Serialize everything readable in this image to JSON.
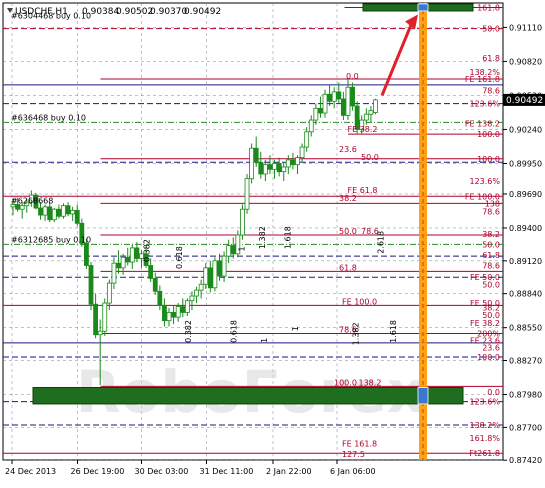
{
  "header": {
    "symbol": "USDCHF,H1",
    "open": "0.90384",
    "high": "0.90502",
    "low": "0.90370",
    "close": "0.90492"
  },
  "watermark": "RoboForex",
  "current_price_label": "0.90492",
  "colors": {
    "candle_up": "#1a8a1a",
    "candle_down": "#1a8a1a",
    "level_red": "#b0002a",
    "level_blue": "#1a1a80",
    "grid": "#3a4a8a",
    "orange_line": "#ff9900",
    "green_box": "#1f6e1f",
    "arrow": "#e0202a",
    "fib_label": "#b0002a"
  },
  "chart_data": {
    "type": "candlestick",
    "title": "USDCHF,H1",
    "xlabel": "",
    "ylabel": "",
    "ylim": [
      0.87422,
      0.91318
    ],
    "y_ticks": [
      "0.91110",
      "0.90820",
      "0.90530",
      "0.90240",
      "0.89950",
      "0.89690",
      "0.89400",
      "0.89120",
      "0.88840",
      "0.88550",
      "0.88270",
      "0.87980",
      "0.87700",
      "0.87420"
    ],
    "x_ticks": [
      "24 Dec 2013",
      "26 Dec 19:00",
      "30 Dec 03:00",
      "31 Dec 11:00",
      "2 Jan 22:00",
      "6 Jan 06:00"
    ],
    "right_fib_labels": [
      {
        "text": "161.8",
        "price": 0.9128
      },
      {
        "text": "50.0",
        "price": 0.911
      },
      {
        "text": "61.8",
        "price": 0.9085
      },
      {
        "text": "138.2%",
        "price": 0.9073
      },
      {
        "text": "FE 161.8",
        "price": 0.9067
      },
      {
        "text": "78.6",
        "price": 0.9057
      },
      {
        "text": "123.6%",
        "price": 0.9046
      },
      {
        "text": "FE 138.2",
        "price": 0.9029
      },
      {
        "text": "100.0",
        "price": 0.902
      },
      {
        "text": "100.0",
        "price": 0.8999
      },
      {
        "text": "123.6%",
        "price": 0.898
      },
      {
        "text": "FE 100.0",
        "price": 0.8967
      },
      {
        "text": "138",
        "price": 0.8961
      },
      {
        "text": "78.6",
        "price": 0.8954
      },
      {
        "text": "38.2",
        "price": 0.8935
      },
      {
        "text": "50.0",
        "price": 0.8926
      },
      {
        "text": "61.8",
        "price": 0.8917
      },
      {
        "text": "78.6",
        "price": 0.8908
      },
      {
        "text": "FE 50.0",
        "price": 0.8898
      },
      {
        "text": "50.0",
        "price": 0.8892
      },
      {
        "text": "FE 50.0",
        "price": 0.8876
      },
      {
        "text": "38.2",
        "price": 0.8872
      },
      {
        "text": "50.0",
        "price": 0.8866
      },
      {
        "text": "FE 38.2",
        "price": 0.8859
      },
      {
        "text": "200%",
        "price": 0.885
      },
      {
        "text": "FE 23.6",
        "price": 0.8844
      },
      {
        "text": "23.6",
        "price": 0.8838
      },
      {
        "text": "100.0",
        "price": 0.883
      },
      {
        "text": "0.0",
        "price": 0.88
      },
      {
        "text": "123.6%",
        "price": 0.8792
      },
      {
        "text": "138.2%",
        "price": 0.8772
      },
      {
        "text": "161.8%",
        "price": 0.8761
      },
      {
        "text": "Ft261.8",
        "price": 0.8748
      }
    ],
    "inner_fib_labels": [
      {
        "text": "0.0",
        "price": 0.9066,
        "offset": 0.686
      },
      {
        "text": "FE 38.2",
        "price": 0.9021,
        "offset": 0.689
      },
      {
        "text": "23.6",
        "price": 0.9004,
        "offset": 0.672
      },
      {
        "text": "50.0",
        "price": 0.8997,
        "offset": 0.716
      },
      {
        "text": "FE 61.8",
        "price": 0.8969,
        "offset": 0.689
      },
      {
        "text": "38.2",
        "price": 0.8962,
        "offset": 0.672
      },
      {
        "text": "50.0",
        "price": 0.8934,
        "offset": 0.672
      },
      {
        "text": "78.6",
        "price": 0.8934,
        "offset": 0.716
      },
      {
        "text": "61.8",
        "price": 0.8903,
        "offset": 0.672
      },
      {
        "text": "FE 100.0",
        "price": 0.8874,
        "offset": 0.678
      },
      {
        "text": "78.6",
        "price": 0.885,
        "offset": 0.672
      },
      {
        "text": "100.0",
        "price": 0.8805,
        "offset": 0.662
      },
      {
        "text": "138.2",
        "price": 0.8805,
        "offset": 0.711
      },
      {
        "text": "FE 161.8",
        "price": 0.8753,
        "offset": 0.678
      },
      {
        "text": "127.5",
        "price": 0.8744,
        "offset": 0.678
      }
    ],
    "order_labels": [
      {
        "text": "#636468 buy 0.10",
        "price": 0.903
      },
      {
        "text": "#6268668",
        "price": 0.8959
      },
      {
        "text": "#6312685 buy 0.10",
        "price": 0.8926
      },
      {
        "text": "#6304468 buy 0.10",
        "price": 0.9117
      }
    ],
    "vertical_fib_labels": [
      {
        "text": "0.382",
        "price": 0.8911,
        "offset": 0.293
      },
      {
        "text": "0.618",
        "price": 0.8905,
        "offset": 0.358
      },
      {
        "text": "0.382",
        "price": 0.8842,
        "offset": 0.376
      },
      {
        "text": "0.618",
        "price": 0.8842,
        "offset": 0.467
      },
      {
        "text": "1",
        "price": 0.8842,
        "offset": 0.528
      },
      {
        "text": "1",
        "price": 0.892,
        "offset": 0.483
      },
      {
        "text": "1.382",
        "price": 0.8922,
        "offset": 0.524
      },
      {
        "text": "1.618",
        "price": 0.8922,
        "offset": 0.575
      },
      {
        "text": "2.618",
        "price": 0.8918,
        "offset": 0.761
      },
      {
        "text": "1",
        "price": 0.8852,
        "offset": 0.59
      },
      {
        "text": "1.382",
        "price": 0.884,
        "offset": 0.711
      },
      {
        "text": "1.618",
        "price": 0.8842,
        "offset": 0.786
      }
    ],
    "candles": [
      [
        0.8958,
        0.8965,
        0.8951,
        0.896
      ],
      [
        0.896,
        0.8966,
        0.8954,
        0.8956
      ],
      [
        0.8956,
        0.8962,
        0.8948,
        0.8959
      ],
      [
        0.8959,
        0.8965,
        0.8953,
        0.8962
      ],
      [
        0.8962,
        0.8972,
        0.8958,
        0.8968
      ],
      [
        0.8968,
        0.897,
        0.8956,
        0.8957
      ],
      [
        0.8957,
        0.8962,
        0.8947,
        0.8951
      ],
      [
        0.8951,
        0.896,
        0.8946,
        0.8958
      ],
      [
        0.8958,
        0.8962,
        0.8945,
        0.8947
      ],
      [
        0.8947,
        0.8957,
        0.8945,
        0.8956
      ],
      [
        0.8956,
        0.896,
        0.8948,
        0.895
      ],
      [
        0.895,
        0.8961,
        0.8948,
        0.8959
      ],
      [
        0.8959,
        0.8962,
        0.895,
        0.8952
      ],
      [
        0.8952,
        0.8958,
        0.8946,
        0.8955
      ],
      [
        0.8955,
        0.896,
        0.8942,
        0.8944
      ],
      [
        0.8944,
        0.8948,
        0.8924,
        0.8927
      ],
      [
        0.8927,
        0.8931,
        0.8905,
        0.8908
      ],
      [
        0.8908,
        0.8911,
        0.887,
        0.8875
      ],
      [
        0.8875,
        0.8884,
        0.8846,
        0.8849
      ],
      [
        0.8849,
        0.8862,
        0.8806,
        0.8852
      ],
      [
        0.8852,
        0.888,
        0.8848,
        0.8876
      ],
      [
        0.8876,
        0.8896,
        0.887,
        0.8893
      ],
      [
        0.8893,
        0.8915,
        0.8888,
        0.891
      ],
      [
        0.891,
        0.8921,
        0.8901,
        0.8906
      ],
      [
        0.8906,
        0.8918,
        0.89,
        0.8915
      ],
      [
        0.8915,
        0.8923,
        0.8908,
        0.8911
      ],
      [
        0.8911,
        0.8926,
        0.8905,
        0.8923
      ],
      [
        0.8923,
        0.8928,
        0.8911,
        0.8914
      ],
      [
        0.8914,
        0.8921,
        0.8906,
        0.8918
      ],
      [
        0.8918,
        0.8924,
        0.8906,
        0.8908
      ],
      [
        0.8908,
        0.8914,
        0.8894,
        0.8897
      ],
      [
        0.8897,
        0.8902,
        0.8883,
        0.8886
      ],
      [
        0.8886,
        0.8891,
        0.887,
        0.8874
      ],
      [
        0.8874,
        0.888,
        0.8856,
        0.8861
      ],
      [
        0.8861,
        0.8872,
        0.8856,
        0.8868
      ],
      [
        0.8868,
        0.8874,
        0.8858,
        0.8864
      ],
      [
        0.8864,
        0.8876,
        0.886,
        0.8873
      ],
      [
        0.8873,
        0.888,
        0.8864,
        0.8868
      ],
      [
        0.8868,
        0.888,
        0.8865,
        0.8878
      ],
      [
        0.8878,
        0.8886,
        0.887,
        0.8882
      ],
      [
        0.8882,
        0.889,
        0.8876,
        0.8887
      ],
      [
        0.8887,
        0.8896,
        0.888,
        0.8892
      ],
      [
        0.8892,
        0.891,
        0.8888,
        0.8906
      ],
      [
        0.8906,
        0.8912,
        0.8885,
        0.8889
      ],
      [
        0.8889,
        0.8915,
        0.8886,
        0.8912
      ],
      [
        0.8912,
        0.8918,
        0.8895,
        0.8899
      ],
      [
        0.8899,
        0.892,
        0.8894,
        0.8916
      ],
      [
        0.8916,
        0.893,
        0.891,
        0.8925
      ],
      [
        0.8925,
        0.8932,
        0.8914,
        0.8918
      ],
      [
        0.8918,
        0.8938,
        0.8915,
        0.8934
      ],
      [
        0.8934,
        0.896,
        0.893,
        0.8956
      ],
      [
        0.8956,
        0.8986,
        0.8952,
        0.8982
      ],
      [
        0.8982,
        0.9012,
        0.8978,
        0.9008
      ],
      [
        0.9008,
        0.9018,
        0.8992,
        0.8996
      ],
      [
        0.8996,
        0.9005,
        0.8982,
        0.8986
      ],
      [
        0.8986,
        0.8998,
        0.898,
        0.8994
      ],
      [
        0.8994,
        0.9002,
        0.8986,
        0.899
      ],
      [
        0.899,
        0.8998,
        0.8982,
        0.8995
      ],
      [
        0.8995,
        0.9,
        0.8984,
        0.8988
      ],
      [
        0.8988,
        0.8996,
        0.898,
        0.8992
      ],
      [
        0.8992,
        0.9002,
        0.8986,
        0.8998
      ],
      [
        0.8998,
        0.9004,
        0.899,
        0.8994
      ],
      [
        0.8994,
        0.9002,
        0.8986,
        0.9
      ],
      [
        0.9,
        0.9012,
        0.8996,
        0.9009
      ],
      [
        0.9009,
        0.9026,
        0.9005,
        0.9022
      ],
      [
        0.9022,
        0.9036,
        0.9018,
        0.9032
      ],
      [
        0.9032,
        0.9046,
        0.9028,
        0.9042
      ],
      [
        0.9042,
        0.9052,
        0.9034,
        0.9038
      ],
      [
        0.9038,
        0.9058,
        0.9034,
        0.9054
      ],
      [
        0.9054,
        0.9062,
        0.9044,
        0.9048
      ],
      [
        0.9048,
        0.906,
        0.9042,
        0.9056
      ],
      [
        0.9056,
        0.9064,
        0.9046,
        0.905
      ],
      [
        0.905,
        0.9056,
        0.9032,
        0.9036
      ],
      [
        0.9036,
        0.9068,
        0.9032,
        0.906
      ],
      [
        0.906,
        0.9064,
        0.904,
        0.9044
      ],
      [
        0.9044,
        0.9048,
        0.902,
        0.9024
      ],
      [
        0.9024,
        0.9036,
        0.902,
        0.9032
      ],
      [
        0.9032,
        0.9042,
        0.9028,
        0.9037
      ],
      [
        0.9037,
        0.9044,
        0.903,
        0.904
      ],
      [
        0.90384,
        0.90502,
        0.9037,
        0.90492
      ]
    ],
    "horizontal_levels": [
      {
        "price": 0.9128,
        "style": "solid",
        "color": "red",
        "from": 0.683
      },
      {
        "price": 0.911,
        "style": "dash",
        "color": "red",
        "from": 0.0
      },
      {
        "price": 0.9067,
        "style": "solid",
        "color": "red",
        "from": 0.195
      },
      {
        "price": 0.9062,
        "style": "solid",
        "color": "blue",
        "from": 0.0
      },
      {
        "price": 0.9046,
        "style": "dash",
        "color": "blue",
        "from": 0.0
      },
      {
        "price": 0.903,
        "style": "dashdot",
        "color": "green",
        "from": 0.0
      },
      {
        "price": 0.902,
        "style": "solid",
        "color": "red",
        "from": 0.69
      },
      {
        "price": 0.8999,
        "style": "solid",
        "color": "red",
        "from": 0.195
      },
      {
        "price": 0.8996,
        "style": "dash",
        "color": "blue",
        "from": 0.0
      },
      {
        "price": 0.8967,
        "style": "solid",
        "color": "red",
        "from": 0.0
      },
      {
        "price": 0.8961,
        "style": "solid",
        "color": "red",
        "from": 0.195
      },
      {
        "price": 0.8934,
        "style": "solid",
        "color": "red",
        "from": 0.195
      },
      {
        "price": 0.8926,
        "style": "dashdot",
        "color": "green",
        "from": 0.0
      },
      {
        "price": 0.8916,
        "style": "dash",
        "color": "blue",
        "from": 0.0
      },
      {
        "price": 0.8903,
        "style": "solid",
        "color": "red",
        "from": 0.195
      },
      {
        "price": 0.8898,
        "style": "dash",
        "color": "blue",
        "from": 0.0
      },
      {
        "price": 0.8874,
        "style": "solid",
        "color": "red",
        "from": 0.0
      },
      {
        "price": 0.885,
        "style": "solid",
        "color": "red",
        "from": 0.195
      },
      {
        "price": 0.8842,
        "style": "solid",
        "color": "blue",
        "from": 0.0
      },
      {
        "price": 0.883,
        "style": "dash",
        "color": "blue",
        "from": 0.0
      },
      {
        "price": 0.8805,
        "style": "solid",
        "color": "red",
        "from": 0.195
      },
      {
        "price": 0.8792,
        "style": "dash",
        "color": "blue",
        "from": 0.0
      },
      {
        "price": 0.8772,
        "style": "dash",
        "color": "blue",
        "from": 0.0
      },
      {
        "price": 0.8748,
        "style": "solid",
        "color": "red",
        "from": 0.0
      }
    ],
    "vertical_dashed_times": [
      "24 Dec 2013",
      "26 Dec 19:00",
      "30 Dec 03:00",
      "31 Dec 11:00",
      "2 Jan 22:00",
      "6 Jan 06:00"
    ],
    "target_zone_upper": [
      0.9125,
      0.9131
    ],
    "target_zone_lower": [
      0.879,
      0.8804
    ],
    "time_target": "after 6 Jan 06:00",
    "grid": true,
    "legend": "none"
  }
}
